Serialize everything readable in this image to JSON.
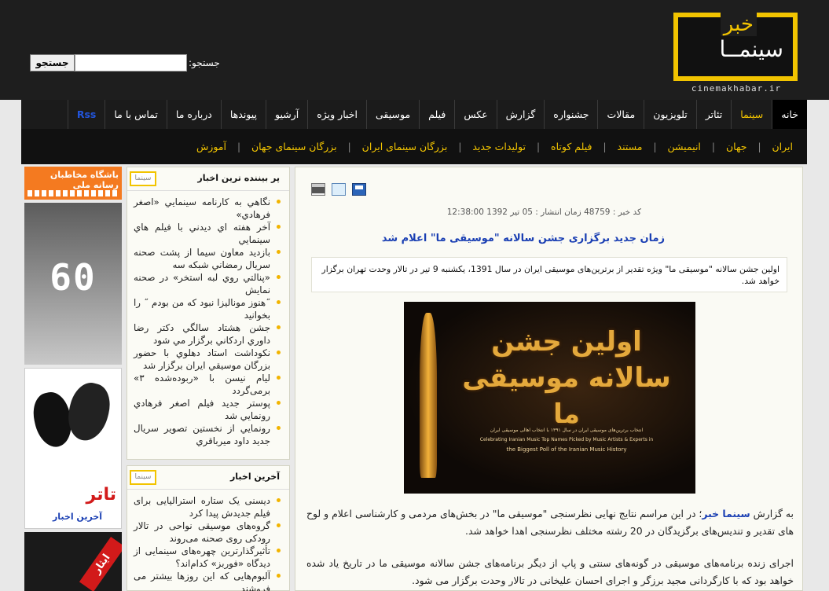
{
  "header": {
    "logo_word1": "خبر",
    "logo_word2": "سینمــا",
    "logo_subtitle": "cinemakhabar.ir",
    "search_label": "جستجو:",
    "search_button": "جستجو",
    "search_value": ""
  },
  "menu": {
    "items": [
      "خانه",
      "سینما",
      "تئاتر",
      "تلویزیون",
      "مقالات",
      "جشنواره",
      "گزارش",
      "عکس",
      "فیلم",
      "موسیقی",
      "اخبار ویژه",
      "آرشیو",
      "پیوندها",
      "درباره ما",
      "تماس با ما",
      "Rss"
    ]
  },
  "submenu": {
    "items": [
      "ایران",
      "جهان",
      "انیمیشن",
      "مستند",
      "فیلم کوتاه",
      "تولیدات جدید",
      "بزرگان سینمای ایران",
      "بزرگان سینمای جهان",
      "آموزش"
    ],
    "separator": "|"
  },
  "ads": {
    "ad1_text": "باشگاه مخاطبان رسانه ملی",
    "ad2_text": "60",
    "ad3_title": "تاتر",
    "ad3_subtitle": "آخرین اخبار",
    "ad4_text": "ایثار"
  },
  "sidebar": {
    "most_viewed": {
      "title": "پر بیننده ترین اخبار",
      "icon_text": "سینما",
      "items": [
        "نگاهي به كارنامه سينمايي «اصغر فرهادي»",
        "آخر هفته اي ديدني با فيلم هاي سينمايي",
        "بازديد معاون سيما از پشت صحنه سريال رمضاني شبكه سه",
        "«پنالتي روي لبه استخر» در صحنه نمايش",
        "˝هنوز مونالیزا نبود که من بودم ˝ را بخوانید",
        "جشن هشتاد سالگي دكتر رضا داوري اردكاني برگزار مي شود",
        "نكوداشت استاد دهلوي با حضور بزرگان موسيقي ايران برگزار شد",
        "لیام نیسن با «ربوده‌شده ۳» برمی‌گردد",
        "پوستر جديد فيلم اصغر فرهادي رونمايي شد",
        "رونمايي از نخستين تصوير سريال جديد داود ميرباقري"
      ]
    },
    "latest": {
      "title": "آخرين اخبار",
      "icon_text": "سینما",
      "items": [
        "دیسنی یک ستاره استرالیایی برای فیلم جدیدش پیدا کرد",
        "گروه‌های موسیقی نواحی در تالار رودکی روی صحنه می‌روند",
        "تأثیرگذارترین چهره‌های سینمایی از دیدگاه «فوربز» کدام‌اند؟",
        "آلبوم‌هایی که این روزها بیشتر می فروشند"
      ]
    }
  },
  "article": {
    "meta": "كد خبر : 48759 زمان انتشار : 05 تير 1392 12:38:00",
    "headline": "زمان جدید برگزاری جشن سالانه \"موسیقی ما\" اعلام شد",
    "lead": "اولین جشن سالانه \"موسیقی ما\" ویژه تقدیر از برترین‌های موسیقی ایران در سال 1391، یکشنبه 9 تیر در تالار وحدت تهران برگزار خواهد شد.",
    "image_title": "اولین جشن سالانه موسیقی ما",
    "image_caption1": "انتخاب برترین‌های موسیقی ایران در سال ۱۳۹۱ با انتخاب اهالی موسیقی ایران",
    "image_caption2": "Celebrating Iranian Music Top Names Picked by Music Artists & Experts in",
    "image_caption3": "the Biggest Poll of the Iranian Music History",
    "p1_prefix": "به گزارش ",
    "p1_source": "سینما خبر",
    "p1_rest": "؛ در این مراسم نتایج نهایی نظرسنجی \"موسیقی ما\" در بخش‌های مردمی و کارشناسی اعلام و لوح های تقدیر و تندیس‌های برگزیدگان در 20 رشته مختلف نظرسنجی اهدا خواهد شد.",
    "p2": "اجرای زنده برنامه‌های موسیقی در گونه‌های سنتی و پاپ از دیگر برنامه‌های جشن سالانه موسیقی ما در تاریخ یاد شده خواهد بود که با کارگردانی مجید برزگر و اجرای احسان علیخانی در تالار وحدت برگزار می شود."
  },
  "colors": {
    "accent": "#f2c400",
    "link_blue": "#1a3fb3",
    "header_bg": "#1e1e1e"
  }
}
